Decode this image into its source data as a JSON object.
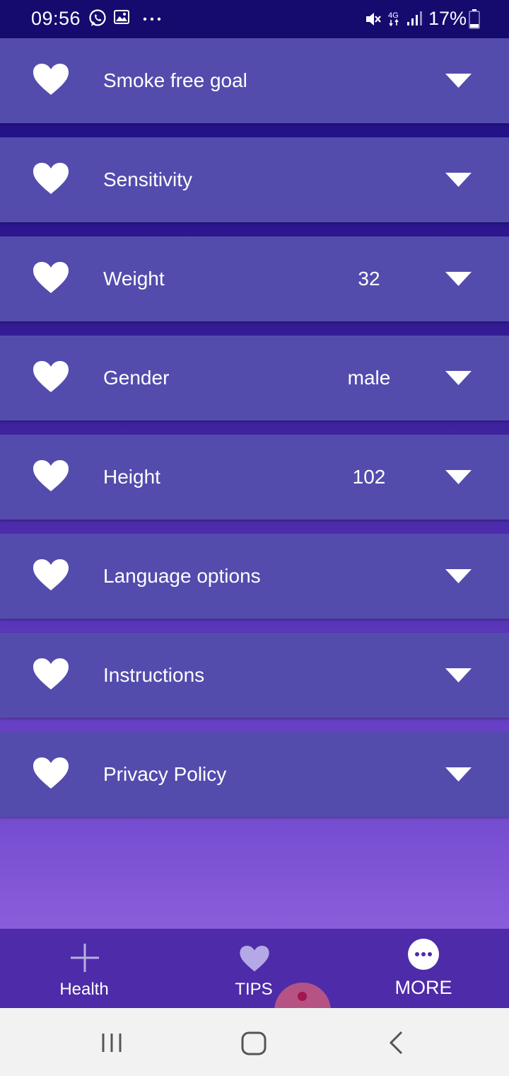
{
  "status_bar": {
    "time": "09:56",
    "icons": [
      "whatsapp-icon",
      "gallery-icon",
      "more-notifications-icon",
      "mute-icon",
      "4g-icon",
      "signal-icon",
      "battery-icon"
    ],
    "battery": "17%"
  },
  "settings": {
    "items": [
      {
        "label": "Smoke free goal",
        "value": ""
      },
      {
        "label": "Sensitivity",
        "value": ""
      },
      {
        "label": "Weight",
        "value": "32"
      },
      {
        "label": "Gender",
        "value": "male"
      },
      {
        "label": "Height",
        "value": "102"
      },
      {
        "label": "Language options",
        "value": ""
      },
      {
        "label": "Instructions",
        "value": ""
      },
      {
        "label": "Privacy Policy",
        "value": ""
      }
    ]
  },
  "bottom_nav": {
    "items": [
      {
        "label": "Health",
        "icon": "plus-icon"
      },
      {
        "label": "TIPS",
        "icon": "heart-icon"
      },
      {
        "label": "MORE",
        "icon": "more-icon"
      }
    ]
  },
  "colors": {
    "status_bar": "#150a6e",
    "row": "#534cad",
    "bottom_nav": "#4e2ba8",
    "system_nav": "#f2f2f2"
  }
}
